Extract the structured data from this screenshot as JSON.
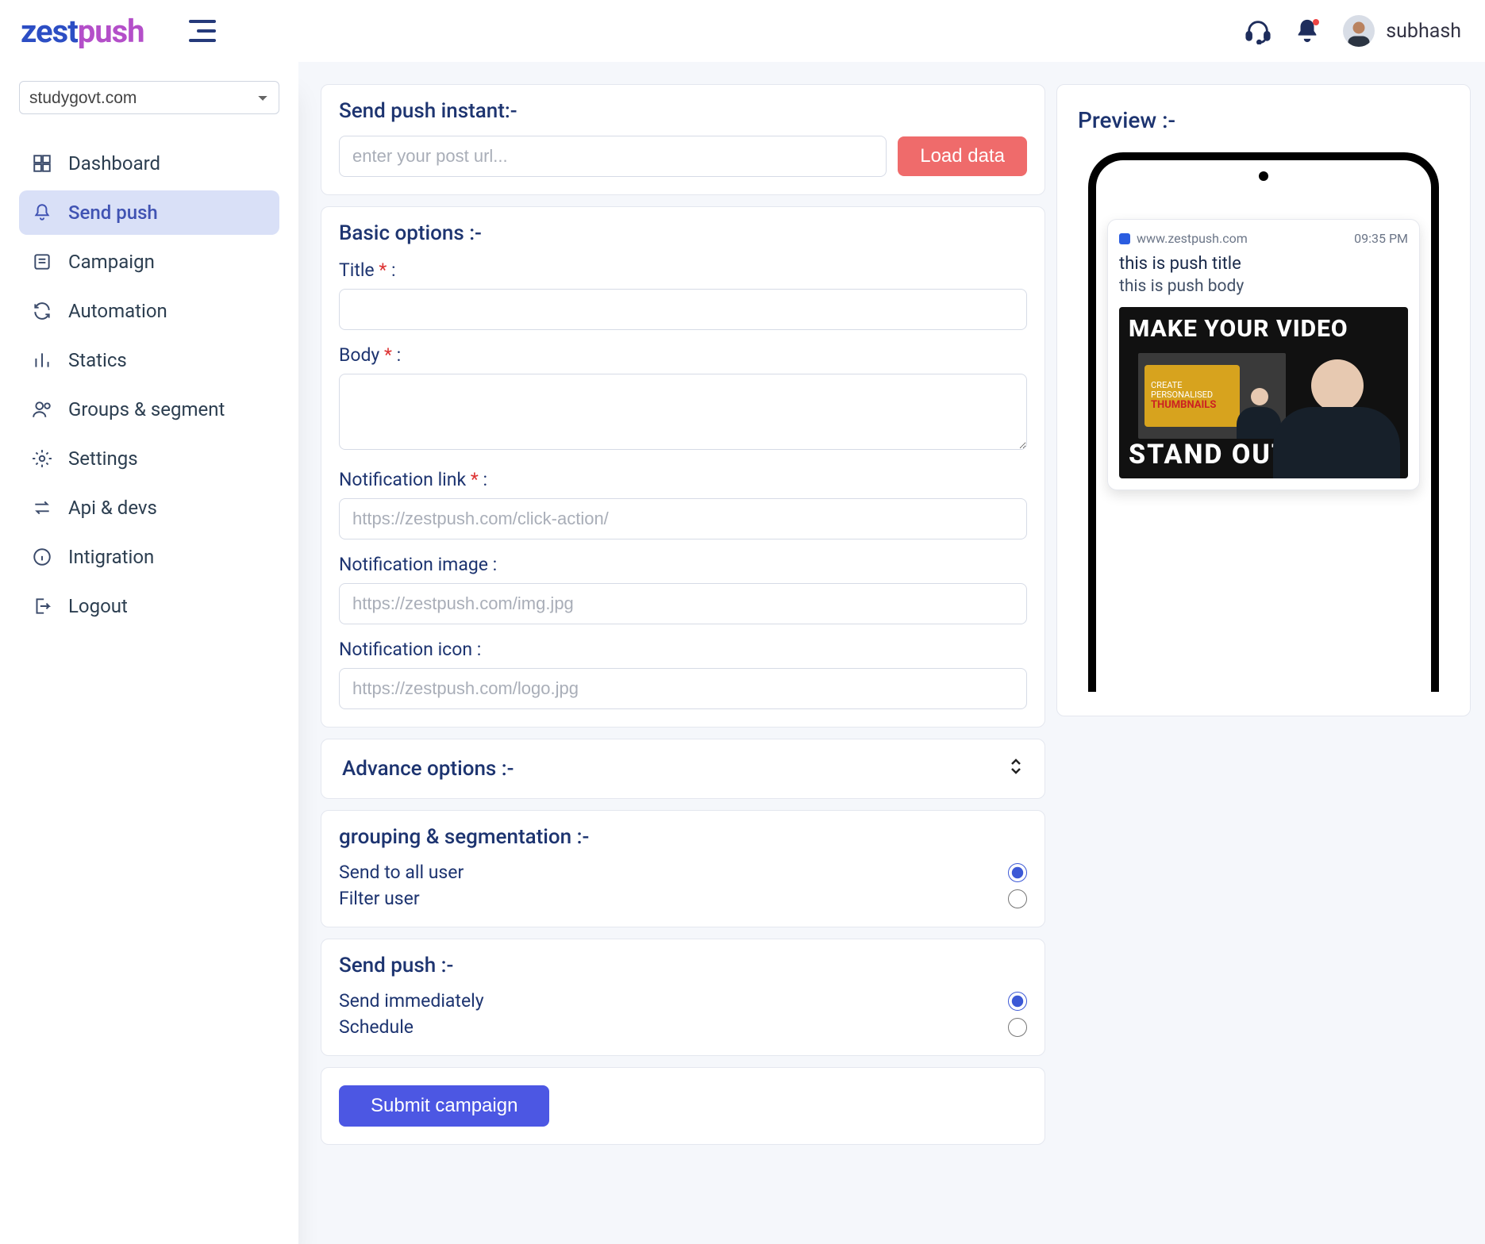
{
  "brand": {
    "pre": "zest",
    "post": "push"
  },
  "header": {
    "username": "subhash"
  },
  "sidebar": {
    "site_selected": "studygovt.com",
    "items": [
      {
        "label": "Dashboard"
      },
      {
        "label": "Send push"
      },
      {
        "label": "Campaign"
      },
      {
        "label": "Automation"
      },
      {
        "label": "Statics"
      },
      {
        "label": "Groups & segment"
      },
      {
        "label": "Settings"
      },
      {
        "label": "Api & devs"
      },
      {
        "label": "Intigration"
      },
      {
        "label": "Logout"
      }
    ]
  },
  "sections": {
    "instant": {
      "title": "Send push instant:-",
      "url_placeholder": "enter your post url...",
      "load_btn": "Load data"
    },
    "basic": {
      "title": "Basic options :-",
      "title_label": "Title ",
      "body_label": "Body ",
      "link_label": "Notification link ",
      "link_placeholder": "https://zestpush.com/click-action/",
      "image_label": "Notification image :",
      "image_placeholder": "https://zestpush.com/img.jpg",
      "icon_label": "Notification icon :",
      "icon_placeholder": "https://zestpush.com/logo.jpg",
      "colon": " :"
    },
    "advance": {
      "title": "Advance options :-"
    },
    "grouping": {
      "title": "grouping & segmentation :-",
      "all": "Send to all user",
      "filter": "Filter user"
    },
    "sendpush": {
      "title": "Send push :-",
      "immediate": "Send immediately",
      "schedule": "Schedule"
    },
    "submit": {
      "label": "Submit campaign"
    }
  },
  "preview": {
    "title": "Preview :-",
    "site": "www.zestpush.com",
    "time": "09:35 PM",
    "push_title": "this is push title",
    "push_body": "this is push body",
    "img_top": "MAKE YOUR VIDEO",
    "img_bottom": "STAND OUT",
    "badge_line1": "CREATE",
    "badge_line2": "PERSONALISED",
    "badge_line3": "THUMBNAILS"
  }
}
